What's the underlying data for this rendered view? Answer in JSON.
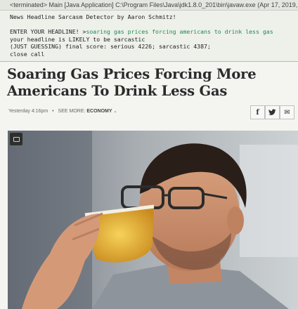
{
  "console": {
    "title": "<terminated> Main [Java Application] C:\\Program Files\\Java\\jdk1.8.0_201\\bin\\javaw.exe (Apr 17, 2019, 4:1",
    "app_line": "News Headline Sarcasm Detector by Aaron Schmitz!",
    "prompt": "ENTER YOUR HEADLINE! >",
    "input": "soaring gas prices forcing americans to drink less gas",
    "result_line": "your headline is LIKELY to be sarcastic",
    "score_line": "(JUST GUESSING) final score: serious 4226; sarcastic 4387;",
    "close_line": "close call"
  },
  "article": {
    "headline": "Soaring Gas Prices Forcing More Americans To Drink Less Gas",
    "timestamp": "Yesterday 4:16pm",
    "see_more": "SEE MORE:",
    "section": "ECONOMY"
  },
  "share": {
    "facebook_glyph": "f",
    "twitter_glyph": "🐦",
    "email_glyph": "✉"
  },
  "colors": {
    "console_input": "#1d8a52",
    "headline": "#2b2b2b"
  }
}
